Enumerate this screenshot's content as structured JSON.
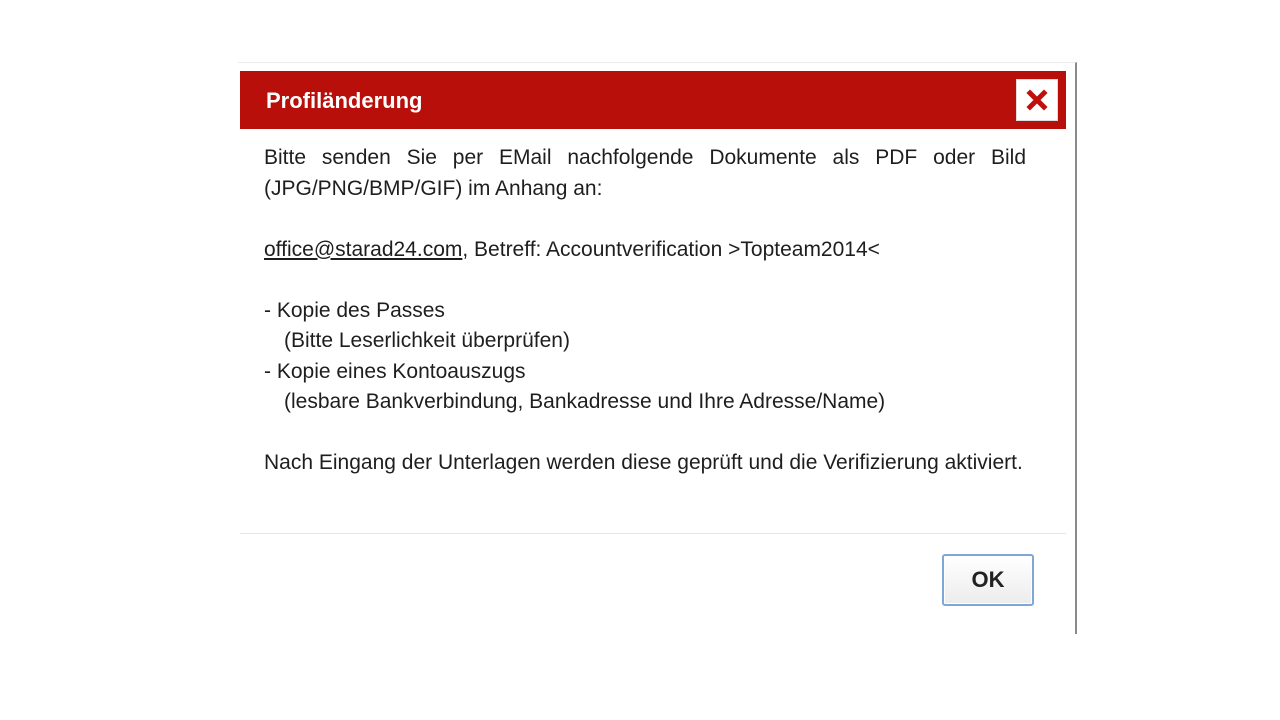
{
  "dialog": {
    "title": "Profiländerung",
    "close_icon": "close-icon",
    "paragraph1": "Bitte senden Sie per EMail nachfolgende Dokumente als PDF oder Bild (JPG/PNG/BMP/GIF) im Anhang an:",
    "email": "office@starad24.com",
    "subject": ", Betreff: Accountverification >Topteam2014<",
    "items": [
      {
        "label": "- Kopie des Passes",
        "note": "(Bitte Leserlichkeit überprüfen)"
      },
      {
        "label": "- Kopie eines Kontoauszugs",
        "note": "(lesbare Bankverbindung, Bankadresse und Ihre Adresse/Name)"
      }
    ],
    "paragraph2": "Nach Eingang der Unterlagen werden diese geprüft und die Verifizierung aktiviert.",
    "ok_label": "OK"
  },
  "colors": {
    "titlebar": "#b80f0a",
    "close_x": "#c0100b",
    "ok_border": "#7fa7d6"
  }
}
